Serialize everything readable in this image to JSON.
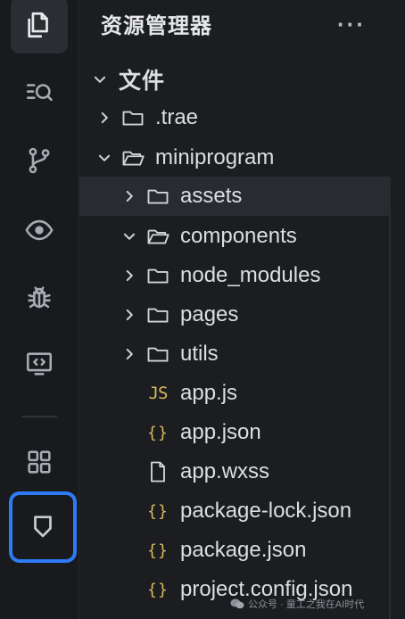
{
  "activity_bar": {
    "items": [
      {
        "icon": "files-icon",
        "active": true
      },
      {
        "icon": "search-icon"
      },
      {
        "icon": "source-control-icon"
      },
      {
        "icon": "eye-icon"
      },
      {
        "icon": "debug-bug-icon"
      },
      {
        "icon": "remote-display-icon"
      },
      {
        "icon": "extensions-grid-icon"
      },
      {
        "icon": "bookmark-shield-icon",
        "highlighted": true
      }
    ],
    "highlight_color": "#2f7bf5"
  },
  "explorer": {
    "title": "资源管理器",
    "more": "···",
    "root_label": "文件",
    "tree": [
      {
        "label": ".trae",
        "type": "folder",
        "expanded": false
      },
      {
        "label": "miniprogram",
        "type": "folder",
        "expanded": true
      },
      {
        "label": "assets",
        "type": "folder",
        "expanded": false,
        "selected": true
      },
      {
        "label": "components",
        "type": "folder",
        "expanded": true
      },
      {
        "label": "node_modules",
        "type": "folder",
        "expanded": false
      },
      {
        "label": "pages",
        "type": "folder",
        "expanded": false
      },
      {
        "label": "utils",
        "type": "folder",
        "expanded": false
      },
      {
        "label": "app.js",
        "type": "js",
        "badge": "JS"
      },
      {
        "label": "app.json",
        "type": "json",
        "badge": "{}"
      },
      {
        "label": "app.wxss",
        "type": "file"
      },
      {
        "label": "package-lock.json",
        "type": "json",
        "badge": "{}"
      },
      {
        "label": "package.json",
        "type": "json",
        "badge": "{}"
      },
      {
        "label": "project.config.json",
        "type": "json",
        "badge": "{}"
      }
    ]
  },
  "watermark": {
    "text": "公众号 · 童工之我在AI时代"
  }
}
